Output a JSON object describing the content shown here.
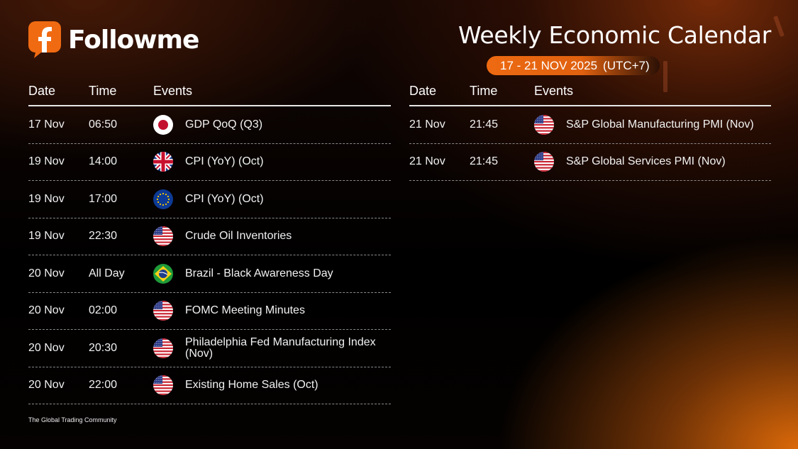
{
  "brand": {
    "name": "Followme"
  },
  "header": {
    "title": "Weekly Economic Calendar",
    "date_range": "17 - 21 NOV 2025",
    "timezone": "(UTC+7)"
  },
  "columns": {
    "date": "Date",
    "time": "Time",
    "events": "Events"
  },
  "left_events": [
    {
      "date": "17 Nov",
      "time": "06:50",
      "flag": "japan-flag-icon",
      "event": "GDP QoQ (Q3)"
    },
    {
      "date": "19 Nov",
      "time": "14:00",
      "flag": "uk-flag-icon",
      "event": "CPI (YoY) (Oct)"
    },
    {
      "date": "19 Nov",
      "time": "17:00",
      "flag": "eu-flag-icon",
      "event": "CPI (YoY) (Oct)"
    },
    {
      "date": "19 Nov",
      "time": "22:30",
      "flag": "us-flag-icon",
      "event": "Crude Oil Inventories"
    },
    {
      "date": "20 Nov",
      "time": "All Day",
      "flag": "brazil-flag-icon",
      "event": "Brazil - Black Awareness Day"
    },
    {
      "date": "20 Nov",
      "time": "02:00",
      "flag": "us-flag-icon",
      "event": "FOMC Meeting Minutes"
    },
    {
      "date": "20 Nov",
      "time": "20:30",
      "flag": "us-flag-icon",
      "event": "Philadelphia Fed Manufacturing Index (Nov)"
    },
    {
      "date": "20 Nov",
      "time": "22:00",
      "flag": "us-flag-icon",
      "event": "Existing Home Sales (Oct)"
    }
  ],
  "right_events": [
    {
      "date": "21 Nov",
      "time": "21:45",
      "flag": "us-flag-icon",
      "event": "S&P Global Manufacturing PMI (Nov)"
    },
    {
      "date": "21 Nov",
      "time": "21:45",
      "flag": "us-flag-icon",
      "event": "S&P Global Services PMI (Nov)"
    }
  ],
  "footer": {
    "tagline": "The Global Trading Community"
  },
  "colors": {
    "accent": "#ee6a12",
    "background": "#000000",
    "text": "#ffffff"
  }
}
